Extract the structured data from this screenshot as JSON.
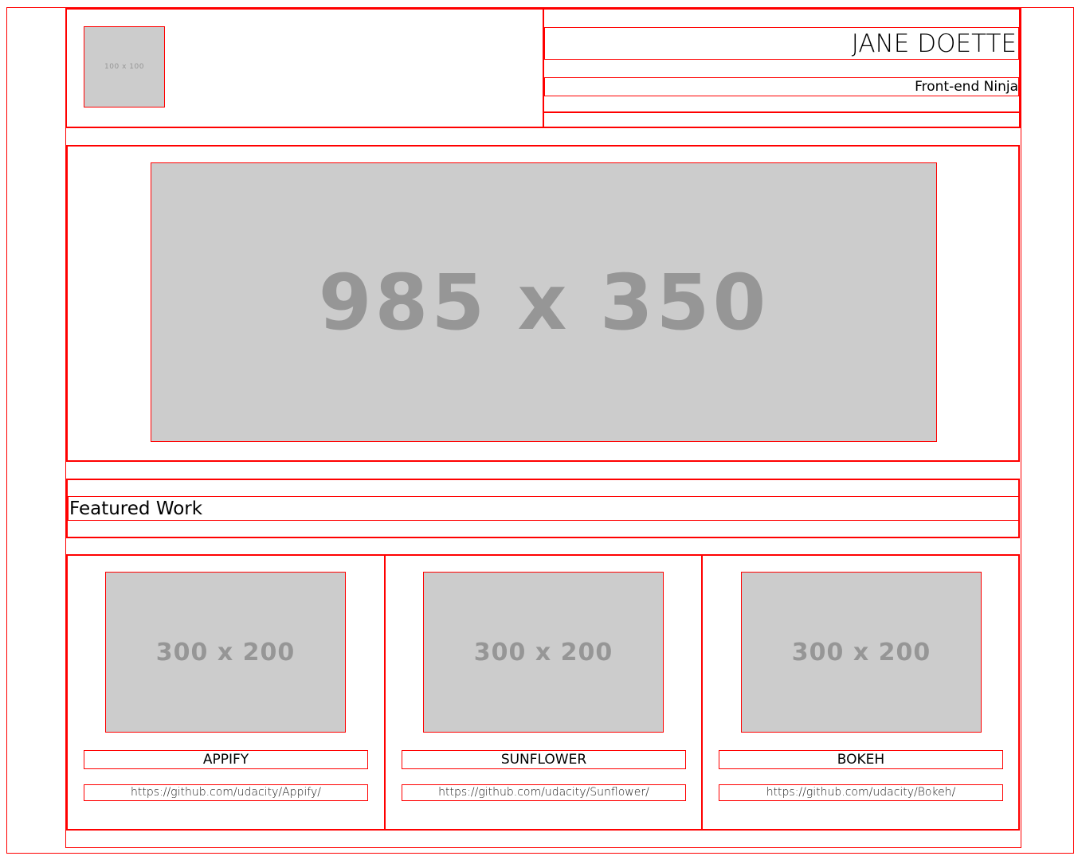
{
  "header": {
    "logo_placeholder": "100 x 100",
    "name": "JANE DOETTE",
    "title": "Front-end Ninja"
  },
  "hero": {
    "placeholder": "985 x 350"
  },
  "featured": {
    "heading": "Featured Work"
  },
  "projects": [
    {
      "placeholder": "300 x 200",
      "name": "APPIFY",
      "link": "https://github.com/udacity/Appify/"
    },
    {
      "placeholder": "300 x 200",
      "name": "SUNFLOWER",
      "link": "https://github.com/udacity/Sunflower/"
    },
    {
      "placeholder": "300 x 200",
      "name": "BOKEH",
      "link": "https://github.com/udacity/Bokeh/"
    }
  ],
  "colors": {
    "outline": "#ff0000",
    "placeholder_bg": "#cccccc",
    "placeholder_text": "#969696"
  }
}
